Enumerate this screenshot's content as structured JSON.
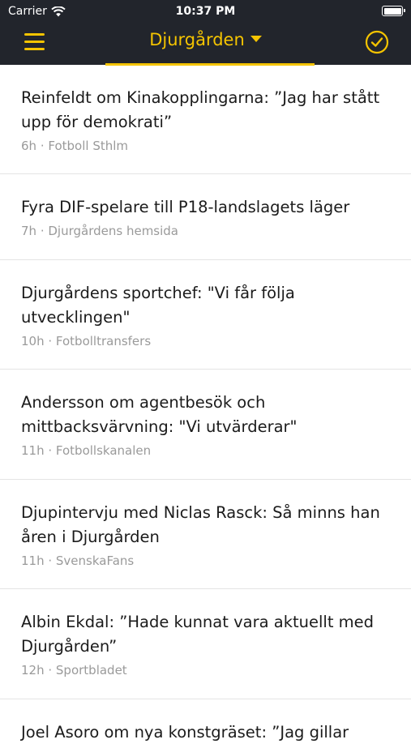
{
  "status_bar": {
    "carrier": "Carrier",
    "time": "10:37 PM"
  },
  "header": {
    "title": "Djurgården"
  },
  "colors": {
    "accent": "#f5c400",
    "header_bg": "#22252c",
    "meta_text": "#9a9a9a"
  },
  "icons": {
    "menu": "hamburger-menu-icon",
    "done": "check-circle-icon",
    "wifi": "wifi-icon",
    "battery": "battery-icon"
  },
  "articles": [
    {
      "headline": "Reinfeldt om Kinakopplingarna: ”Jag har stått upp för demokrati”",
      "age": "6h",
      "source": "Fotboll Sthlm"
    },
    {
      "headline": "Fyra DIF-spelare till P18-landslagets läger",
      "age": "7h",
      "source": "Djurgårdens hemsida"
    },
    {
      "headline": "Djurgårdens sportchef: \"Vi får följa utvecklingen\"",
      "age": "10h",
      "source": "Fotbolltransfers"
    },
    {
      "headline": "Andersson om agentbesök och mittbacksvärvning: \"Vi utvärderar\"",
      "age": "11h",
      "source": "Fotbollskanalen"
    },
    {
      "headline": "Djupintervju med Niclas Rasck: Så minns han åren i Djurgården",
      "age": "11h",
      "source": "SvenskaFans"
    },
    {
      "headline": "Albin Ekdal: ”Hade kunnat vara aktuellt med Djurgården”",
      "age": "12h",
      "source": "Sportbladet"
    },
    {
      "headline": "Joel Asoro om nya konstgräset: ”Jag gillar",
      "age": "",
      "source": ""
    }
  ]
}
